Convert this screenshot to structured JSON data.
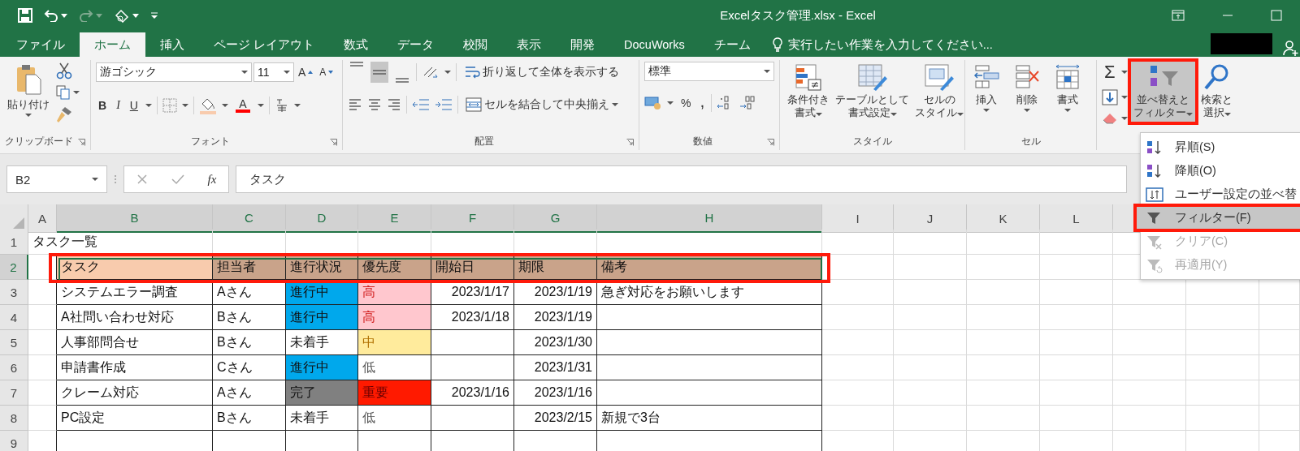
{
  "window": {
    "title": "Excelタスク管理.xlsx - Excel"
  },
  "tabs": [
    {
      "label": "ファイル",
      "selected": false
    },
    {
      "label": "ホーム",
      "selected": true
    },
    {
      "label": "挿入",
      "selected": false
    },
    {
      "label": "ページ レイアウト",
      "selected": false
    },
    {
      "label": "数式",
      "selected": false
    },
    {
      "label": "データ",
      "selected": false
    },
    {
      "label": "校閲",
      "selected": false
    },
    {
      "label": "表示",
      "selected": false
    },
    {
      "label": "開発",
      "selected": false
    },
    {
      "label": "DocuWorks",
      "selected": false
    },
    {
      "label": "チーム",
      "selected": false
    }
  ],
  "tell_me": {
    "placeholder": "実行したい作業を入力してください..."
  },
  "ribbon": {
    "clipboard": {
      "label": "クリップボード",
      "paste": "貼り付け"
    },
    "font": {
      "label": "フォント",
      "name": "游ゴシック",
      "size": "11",
      "grow": "A",
      "shrink": "A",
      "bold": "B",
      "italic": "I",
      "underline": "U",
      "font_color": "A"
    },
    "alignment": {
      "label": "配置",
      "vertical": [
        {
          "selected": false
        },
        {
          "selected": true
        },
        {
          "selected": false
        }
      ],
      "wrap": "折り返して全体を表示する",
      "merge": "セルを結合して中央揃え"
    },
    "number": {
      "label": "数値",
      "format": "標準",
      "percent": "%",
      "comma": ","
    },
    "styles": {
      "label": "スタイル",
      "buttons": [
        {
          "lines": [
            "条件付き",
            "書式"
          ],
          "kind": "conditional"
        },
        {
          "lines": [
            "テーブルとして",
            "書式設定"
          ],
          "kind": "table"
        },
        {
          "lines": [
            "セルの",
            "スタイル"
          ],
          "kind": "cell_style"
        }
      ]
    },
    "cells": {
      "label": "セル",
      "buttons": [
        {
          "label": "挿入",
          "kind": "insert"
        },
        {
          "label": "削除",
          "kind": "delete"
        },
        {
          "label": "書式",
          "kind": "format"
        }
      ]
    },
    "editing": {
      "sum": "Σ",
      "sort_filter": {
        "lines": [
          "並べ替えと",
          "フィルター"
        ],
        "selected": true,
        "annotated": true
      },
      "find": {
        "lines": [
          "検索と",
          "選択"
        ]
      }
    }
  },
  "sort_menu": {
    "items": [
      {
        "label": "昇順(S)",
        "kind": "sort_asc",
        "selected": false,
        "disabled": false,
        "annotated": false
      },
      {
        "label": "降順(O)",
        "kind": "sort_desc",
        "selected": false,
        "disabled": false,
        "annotated": false
      },
      {
        "label": "ユーザー設定の並べ替",
        "kind": "custom_sort",
        "selected": false,
        "disabled": false,
        "annotated": false
      },
      {
        "label": "フィルター(F)",
        "kind": "filter",
        "selected": true,
        "disabled": false,
        "annotated": true
      },
      {
        "label": "クリア(C)",
        "kind": "clear",
        "selected": false,
        "disabled": true,
        "annotated": false
      },
      {
        "label": "再適用(Y)",
        "kind": "reapply",
        "selected": false,
        "disabled": true,
        "annotated": false
      }
    ]
  },
  "formula_bar": {
    "name_box": "B2",
    "fx": "fx",
    "formula": "タスク"
  },
  "sheet": {
    "columns": [
      {
        "label": "A",
        "selected": false
      },
      {
        "label": "B",
        "selected": true
      },
      {
        "label": "C",
        "selected": true
      },
      {
        "label": "D",
        "selected": true
      },
      {
        "label": "E",
        "selected": true
      },
      {
        "label": "F",
        "selected": true
      },
      {
        "label": "G",
        "selected": true
      },
      {
        "label": "H",
        "selected": true
      },
      {
        "label": "I",
        "selected": false
      },
      {
        "label": "J",
        "selected": false
      },
      {
        "label": "K",
        "selected": false
      },
      {
        "label": "L",
        "selected": false
      }
    ],
    "row_numbers": [
      {
        "label": "1",
        "selected": false
      },
      {
        "label": "2",
        "selected": true
      },
      {
        "label": "3",
        "selected": false
      },
      {
        "label": "4",
        "selected": false
      },
      {
        "label": "5",
        "selected": false
      },
      {
        "label": "6",
        "selected": false
      },
      {
        "label": "7",
        "selected": false
      },
      {
        "label": "8",
        "selected": false
      },
      {
        "label": "9",
        "selected": false
      }
    ],
    "title_cell": "タスク一覧",
    "table": {
      "annotated": true,
      "headers": [
        {
          "label": "タスク",
          "color": "#f8cbad"
        },
        {
          "label": "担当者",
          "color": "#c9a38a"
        },
        {
          "label": "進行状況",
          "color": "#c9a38a"
        },
        {
          "label": "優先度",
          "color": "#c9a38a"
        },
        {
          "label": "開始日",
          "color": "#c9a38a"
        },
        {
          "label": "期限",
          "color": "#c9a38a"
        },
        {
          "label": "備考",
          "color": "#c9a38a"
        }
      ],
      "rows": [
        {
          "task": "システムエラー調査",
          "assignee": "Aさん",
          "status": {
            "text": "進行中",
            "kind": "in_progress"
          },
          "priority": {
            "text": "高",
            "kind": "high"
          },
          "start": "2023/1/17",
          "due": "2023/1/19",
          "note": "急ぎ対応をお願いします"
        },
        {
          "task": "A社問い合わせ対応",
          "assignee": "Bさん",
          "status": {
            "text": "進行中",
            "kind": "in_progress"
          },
          "priority": {
            "text": "高",
            "kind": "high"
          },
          "start": "2023/1/18",
          "due": "2023/1/19"
        },
        {
          "task": "人事部問合せ",
          "assignee": "Bさん",
          "status": {
            "text": "未着手",
            "kind": "not_started"
          },
          "priority": {
            "text": "中",
            "kind": "medium"
          },
          "due": "2023/1/30"
        },
        {
          "task": "申請書作成",
          "assignee": "Cさん",
          "status": {
            "text": "進行中",
            "kind": "in_progress"
          },
          "priority": {
            "text": "低",
            "kind": "low"
          },
          "due": "2023/1/31"
        },
        {
          "task": "クレーム対応",
          "assignee": "Aさん",
          "status": {
            "text": "完了",
            "kind": "done"
          },
          "priority": {
            "text": "重要",
            "kind": "critical"
          },
          "start": "2023/1/16",
          "due": "2023/1/16"
        },
        {
          "task": "PC設定",
          "assignee": "Bさん",
          "status": {
            "text": "未着手",
            "kind": "not_started"
          },
          "priority": {
            "text": "低",
            "kind": "low"
          },
          "due": "2023/2/15",
          "note": "新規で3台"
        }
      ]
    }
  }
}
